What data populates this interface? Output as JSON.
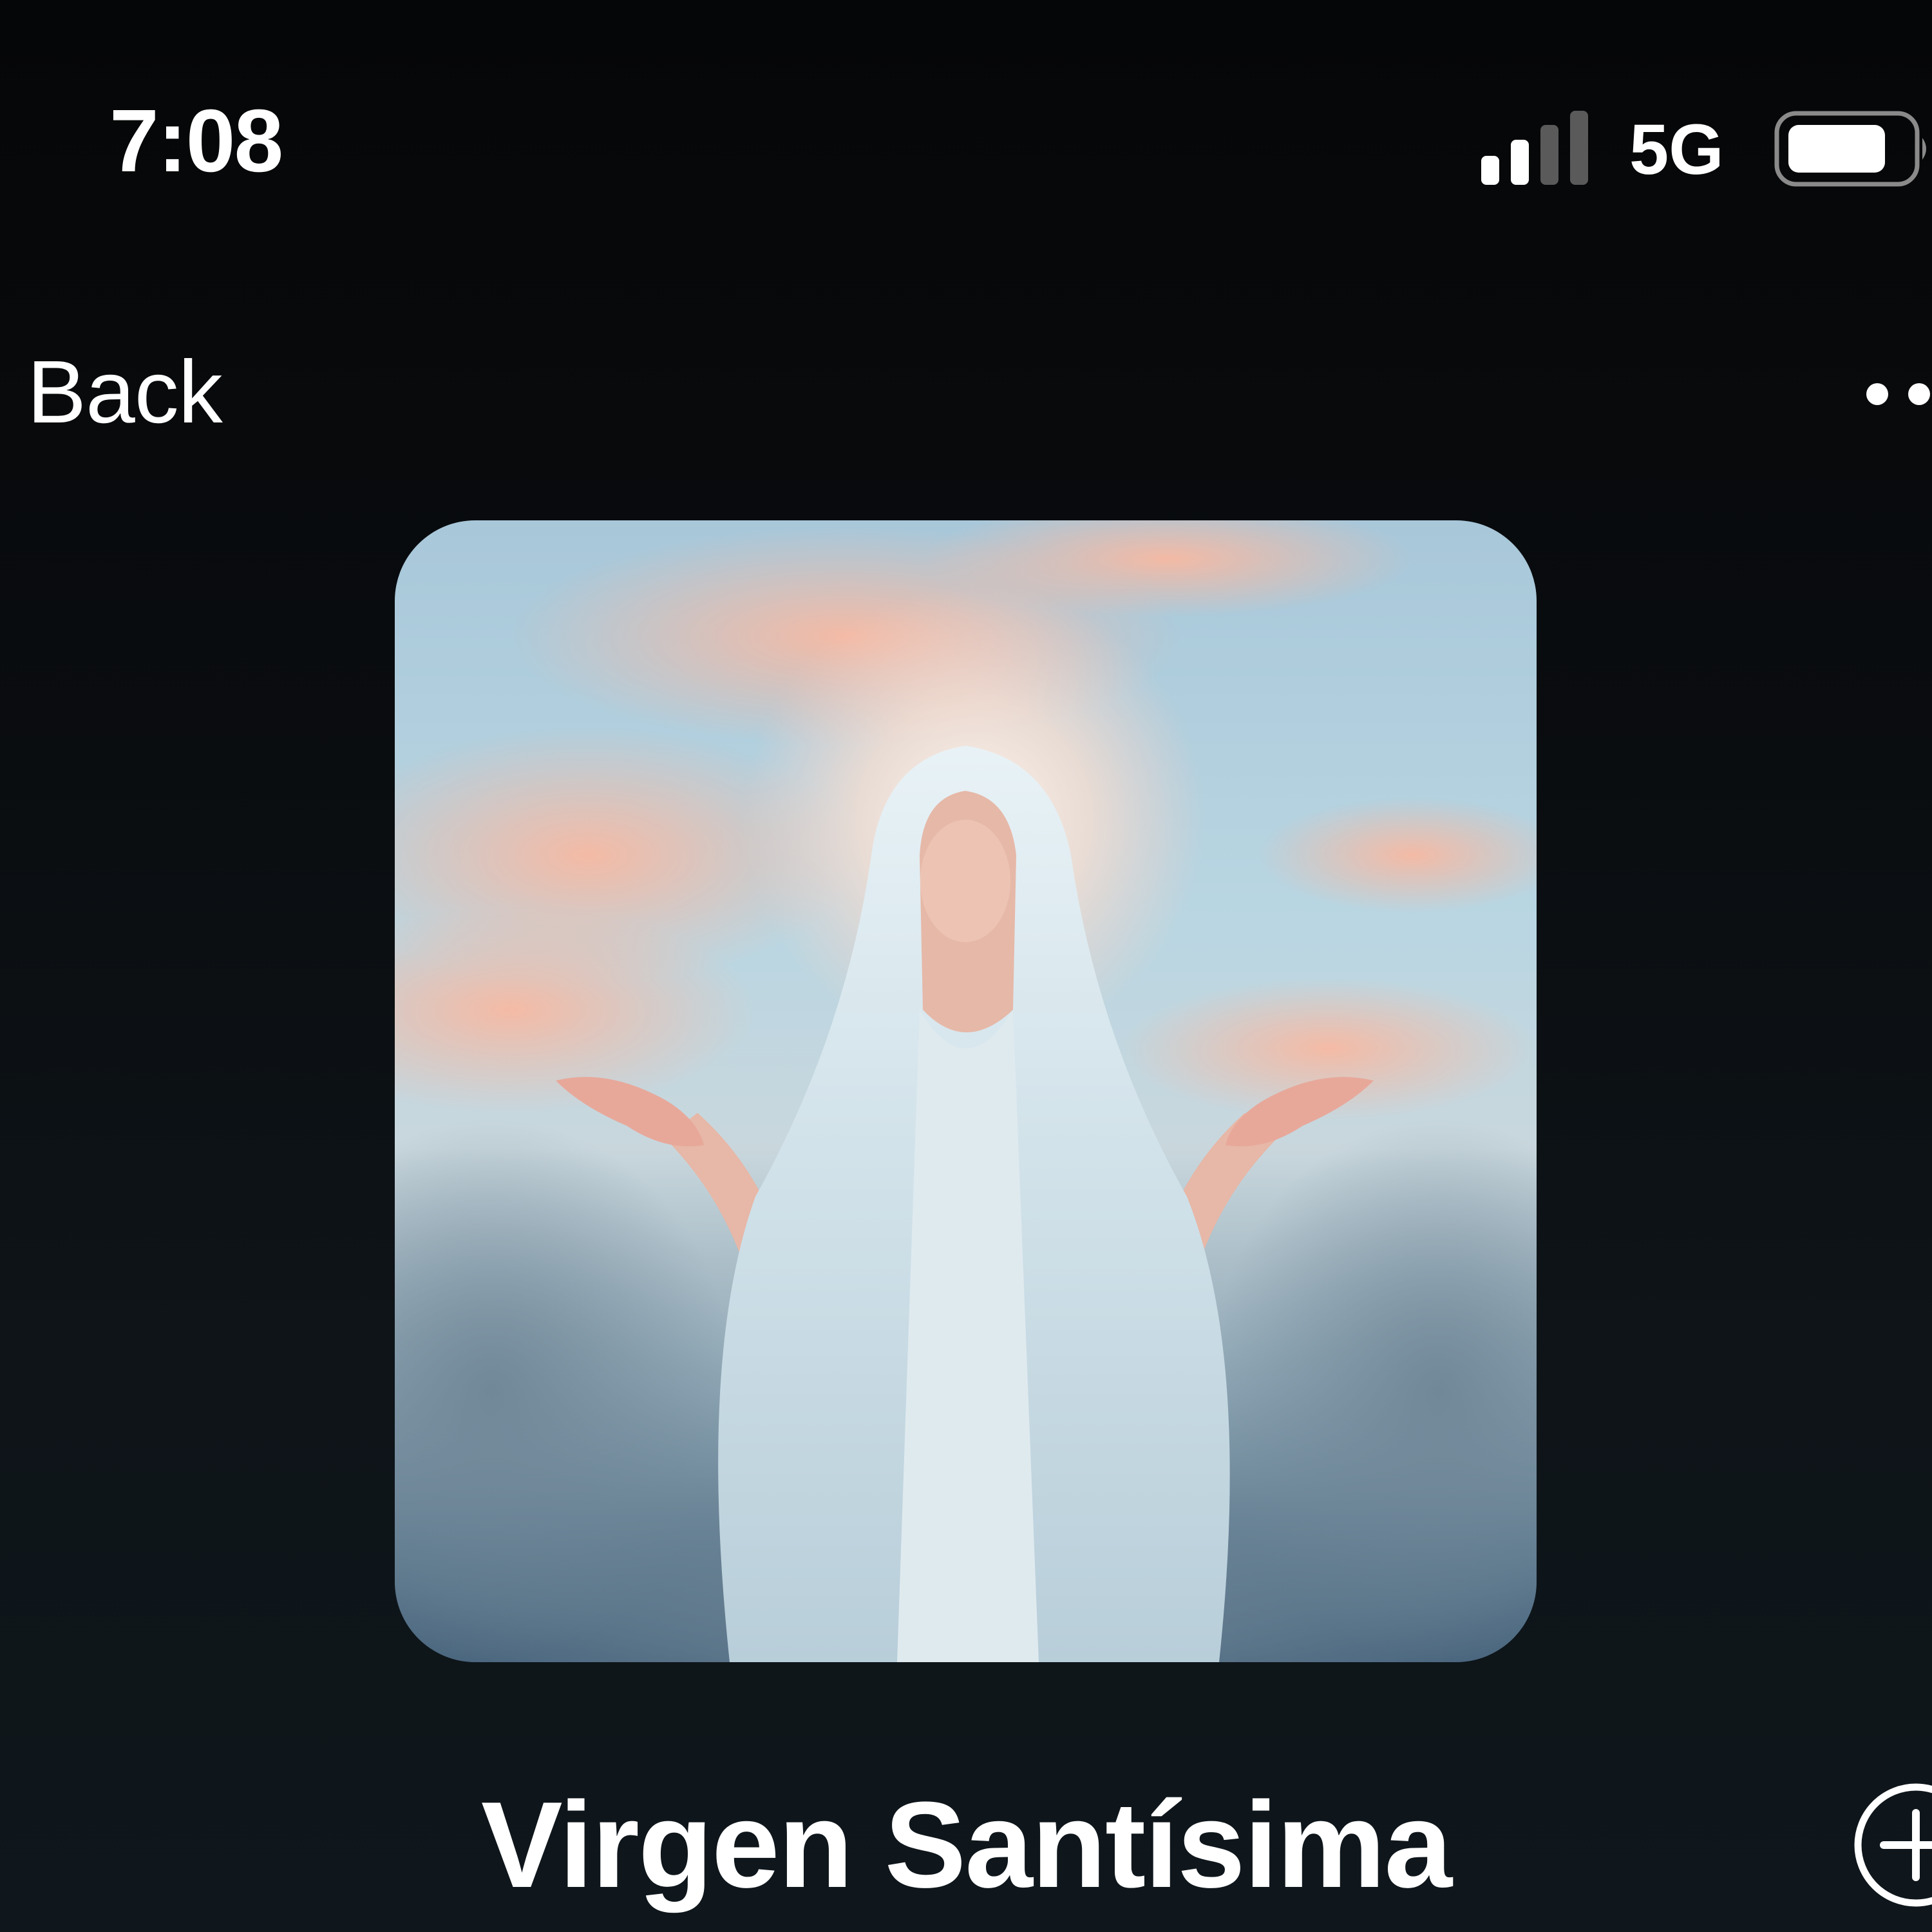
{
  "status_bar": {
    "time": "7:08",
    "network": "5G",
    "signal_bars_active": 2,
    "signal_bars_total": 4,
    "battery_level": 0.75
  },
  "nav": {
    "back_label": "Back",
    "more_icon": "ellipsis-icon"
  },
  "track": {
    "title": "Virgen Santísima",
    "add_icon": "plus-circle-icon"
  },
  "colors": {
    "background": "#07090b",
    "text": "#ffffff",
    "signal_inactive": "#5a5a5a"
  }
}
